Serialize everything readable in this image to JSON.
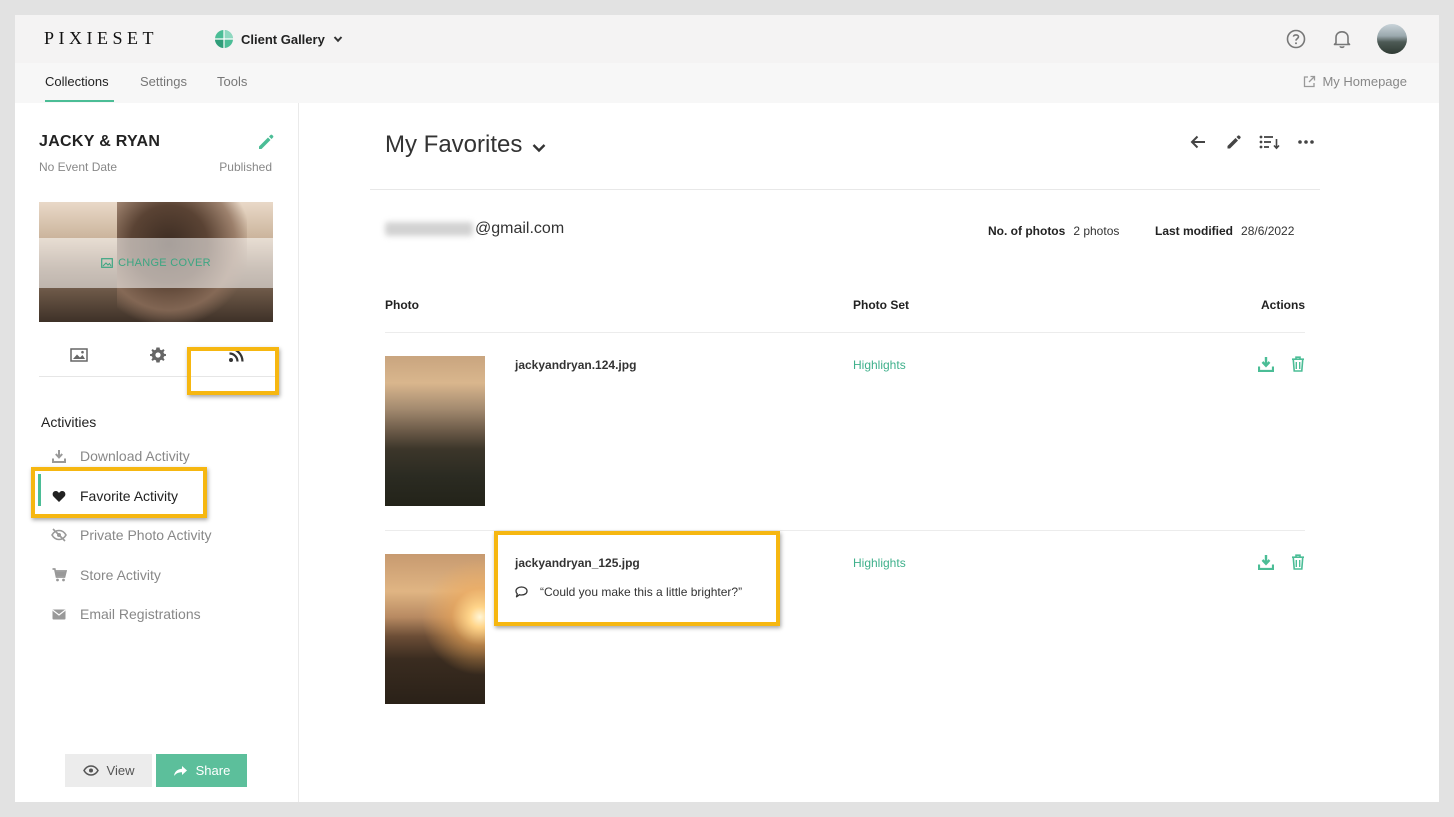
{
  "app": {
    "logo": "PIXIESET",
    "product_selector": "Client Gallery"
  },
  "nav": {
    "tabs": [
      {
        "label": "Collections",
        "active": true
      },
      {
        "label": "Settings",
        "active": false
      },
      {
        "label": "Tools",
        "active": false
      }
    ],
    "homepage_link": "My Homepage"
  },
  "icons": {
    "help": "help-circle-icon",
    "notifications": "bell-icon",
    "avatar": "user-avatar"
  },
  "collection": {
    "title": "JACKY & RYAN",
    "event_date": "No Event Date",
    "status": "Published",
    "change_cover": "CHANGE COVER"
  },
  "sidebar": {
    "section_title": "Activities",
    "items": [
      {
        "label": "Download Activity",
        "icon": "download-icon",
        "active": false
      },
      {
        "label": "Favorite Activity",
        "icon": "heart-icon",
        "active": true
      },
      {
        "label": "Private Photo Activity",
        "icon": "eye-off-icon",
        "active": false
      },
      {
        "label": "Store Activity",
        "icon": "cart-icon",
        "active": false
      },
      {
        "label": "Email Registrations",
        "icon": "envelope-icon",
        "active": false
      }
    ],
    "view_button": "View",
    "share_button": "Share"
  },
  "main": {
    "title": "My Favorites",
    "email_suffix": "@gmail.com",
    "photos_label": "No. of photos",
    "photos_value": "2 photos",
    "modified_label": "Last modified",
    "modified_value": "28/6/2022",
    "columns": {
      "photo": "Photo",
      "set": "Photo Set",
      "actions": "Actions"
    },
    "rows": [
      {
        "filename": "jackyandryan.124.jpg",
        "set": "Highlights",
        "comment": ""
      },
      {
        "filename": "jackyandryan_125.jpg",
        "set": "Highlights",
        "comment": "“Could you make this a little brighter?”"
      }
    ]
  },
  "colors": {
    "accent": "#4bbd96",
    "highlight": "#f6b711"
  }
}
